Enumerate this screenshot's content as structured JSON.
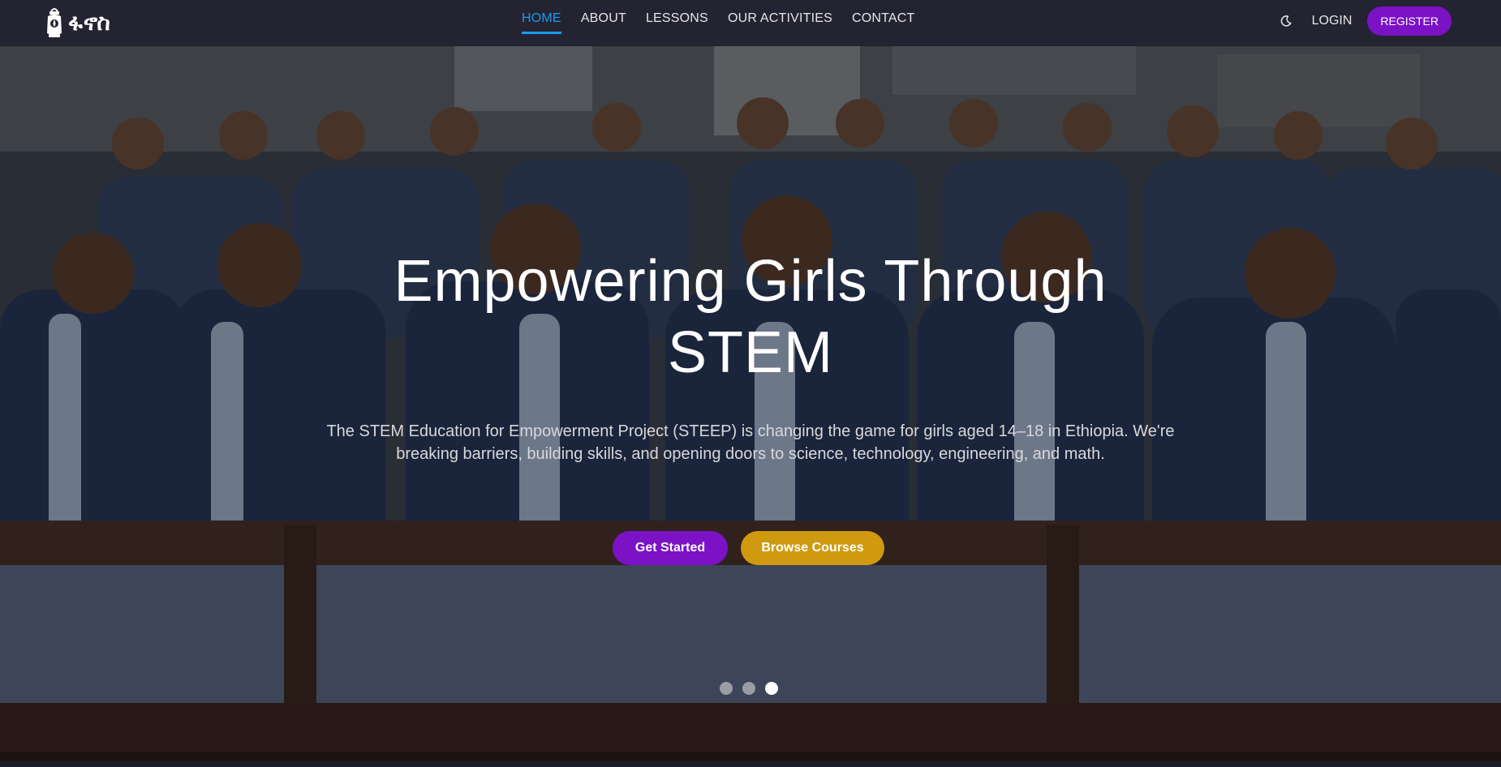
{
  "brand": {
    "logo_text": "ፋኖስ",
    "logo_icon": "lantern-icon"
  },
  "nav": {
    "items": [
      {
        "label": "HOME",
        "active": true
      },
      {
        "label": "ABOUT",
        "active": false
      },
      {
        "label": "LESSONS",
        "active": false
      },
      {
        "label": "OUR ACTIVITIES",
        "active": false
      },
      {
        "label": "CONTACT",
        "active": false
      }
    ],
    "theme_toggle_icon": "moon-icon",
    "login_label": "LOGIN",
    "register_label": "REGISTER"
  },
  "hero": {
    "title_line1": "Empowering Girls Through",
    "title_line2": "STEM",
    "description": "The STEM Education for Empowerment Project (STEEP) is changing the game for girls aged 14–18 in Ethiopia. We're breaking barriers, building skills, and opening doors to science, technology, engineering, and math.",
    "primary_button": "Get Started",
    "secondary_button": "Browse Courses",
    "slides": [
      {
        "active": false
      },
      {
        "active": false
      },
      {
        "active": true
      }
    ]
  },
  "colors": {
    "nav_bg": "#232331",
    "active_link": "#1a9bf0",
    "primary": "#7b12c6",
    "secondary": "#cf9a10"
  }
}
